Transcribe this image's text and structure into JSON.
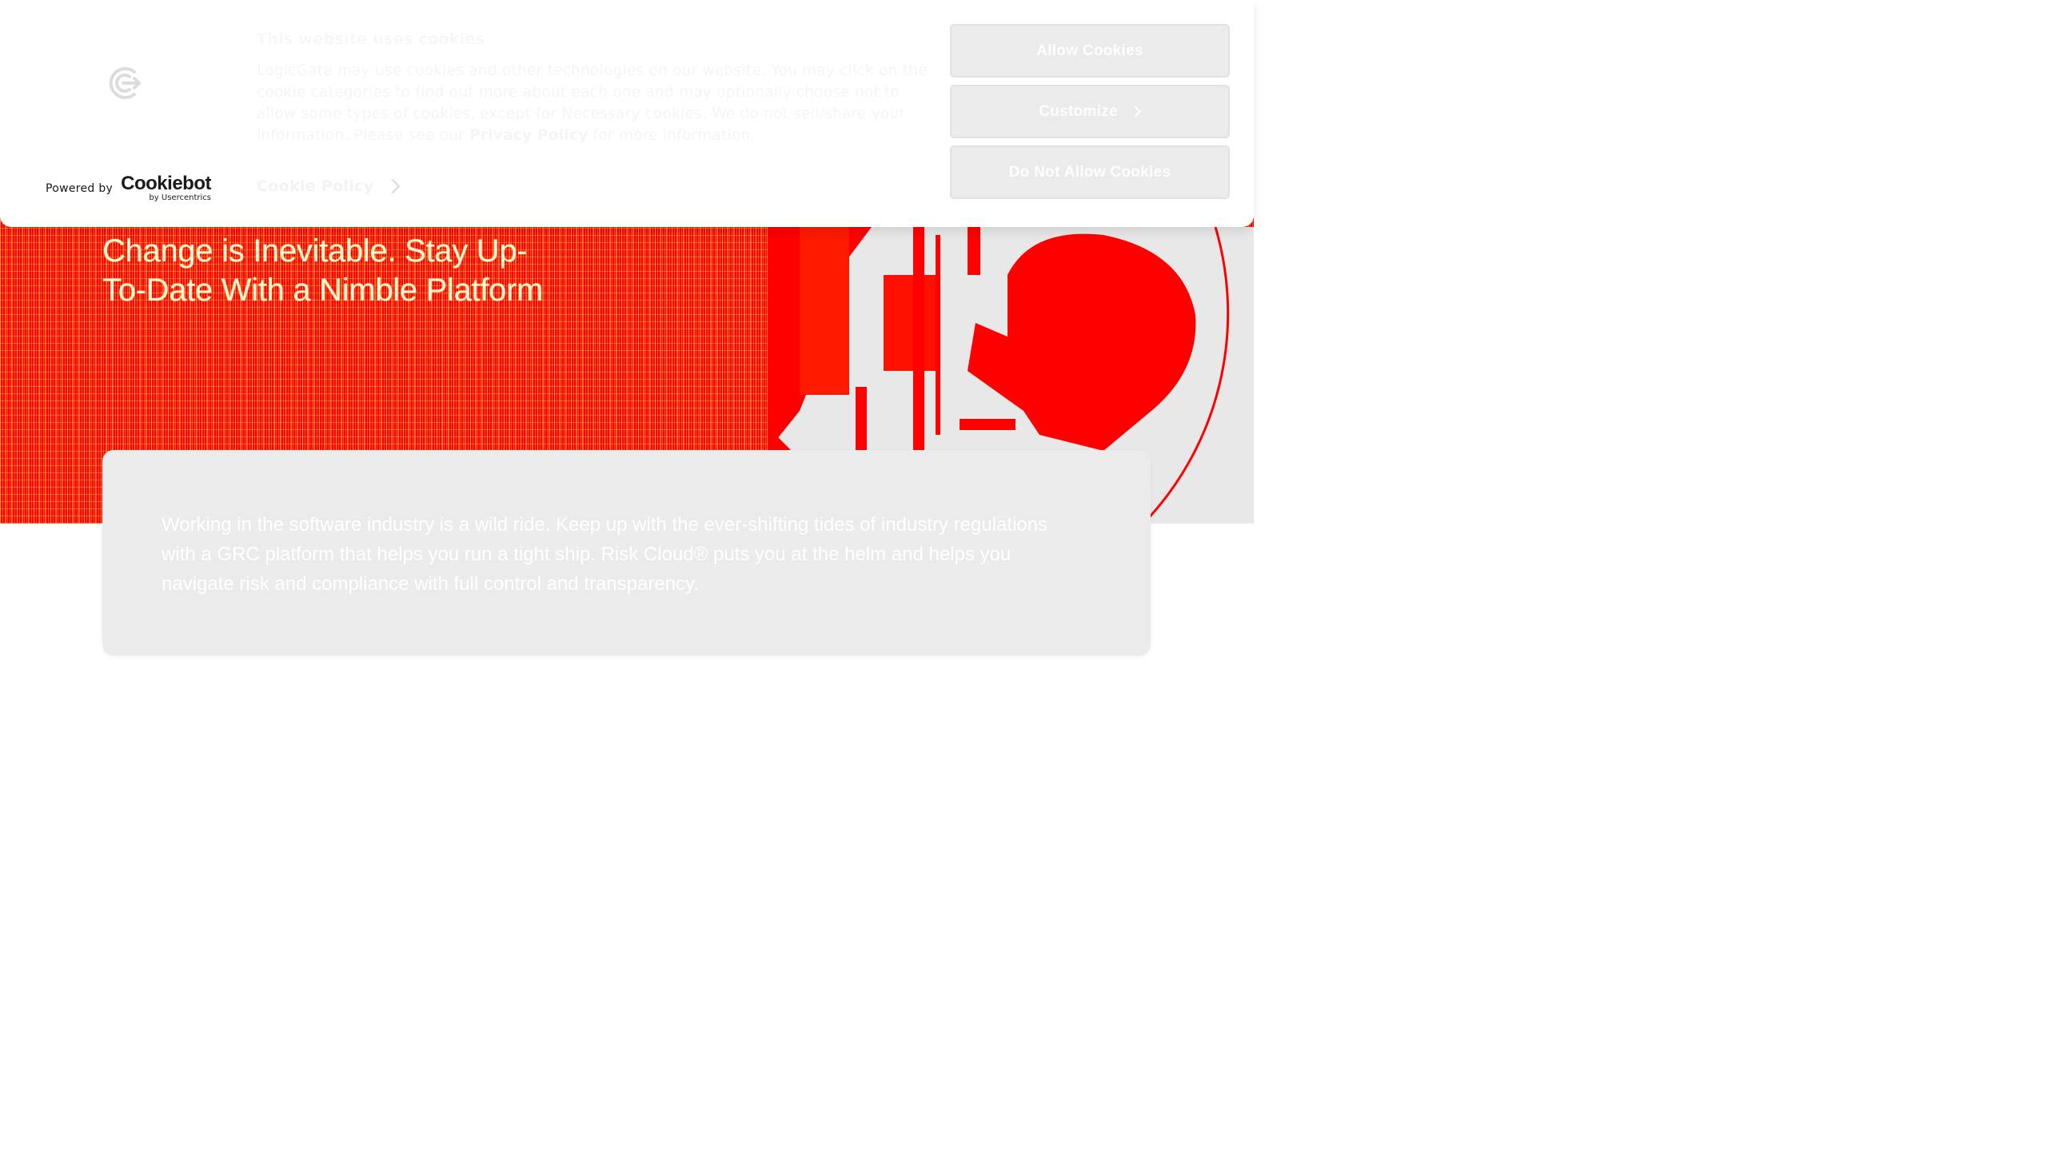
{
  "cookie_banner": {
    "title": "This website uses cookies",
    "body_text": "LogicGate may use cookies and other technologies on our website. You may click on the cookie categories to find out more about each one and may optionally choose not to allow some types of cookies, except for Necessary cookies.  We do not sell/share your information. Please see our ",
    "privacy_link": "Privacy Policy",
    "body_suffix": " for more information.",
    "cookie_policy_link": "Cookie Policy",
    "powered_by": "Powered by",
    "cookiebot_wordmark": "Cookiebot",
    "cookiebot_byline": "by Usercentrics",
    "buttons": {
      "allow": "Allow Cookies",
      "customize": "Customize",
      "deny": "Do Not Allow Cookies"
    }
  },
  "hero": {
    "title_line1": "Change is Inevitable. Stay Up-",
    "title_line2": "To-Date With a Nimble Platform"
  },
  "intro": {
    "text": "Working in the software industry is a wild ride. Keep up with the ever-shifting tides of industry regulations with a GRC platform that helps you run a tight ship. Risk Cloud® puts you at the helm and helps you navigate risk and compliance with full control and transparency."
  },
  "colors": {
    "hero_red": "#ff0000",
    "hero_title": "#fff8d8",
    "card_bg": "#ebebeb",
    "button_bg": "#ebebeb"
  },
  "icons": {
    "brand": "logicgate-logo-icon",
    "chevron": "chevron-right-icon"
  }
}
